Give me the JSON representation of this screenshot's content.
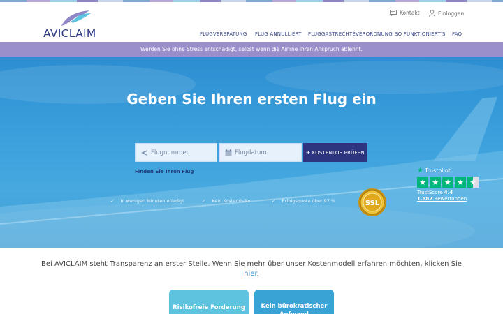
{
  "brand": {
    "name": "AVICLAIM"
  },
  "utility": {
    "contact": "Kontakt",
    "login": "Einloggen"
  },
  "nav": [
    {
      "label": "FLUGVERSPÄTUNG"
    },
    {
      "label": "FLUG ANNULLIERT"
    },
    {
      "label": "FLUGGASTRECHTEVERORDNUNG"
    },
    {
      "label": "SO FUNKTIONIERT'S"
    },
    {
      "label": "FAQ"
    }
  ],
  "banner": {
    "text": "Werden Sie ohne Stress entschädigt, selbst wenn die Airline Ihren Anspruch ablehnt."
  },
  "hero": {
    "title": "Geben Sie Ihren ersten Flug ein",
    "flight_placeholder": "Flugnummer",
    "date_placeholder": "Flugdatum",
    "cta_label": "✈ KOSTENLOS PRÜFEN",
    "find_link": "Finden Sie Ihren Flug",
    "features": [
      "In wenigen Minuten erledigt",
      "Kein Kostenrisiko",
      "Erfolgsquote über 97 %"
    ],
    "ssl_badge": "SSL"
  },
  "trustpilot": {
    "name": "Trustpilot",
    "score_label": "TrustScore",
    "score": "4.4",
    "reviews_count": "1.882",
    "reviews_label": "Bewertungen",
    "rating": 4.5
  },
  "transparency": {
    "text": "Bei AVICLAIM steht Transparenz an erster Stelle. Wenn Sie mehr über unser Kostenmodell erfahren möchten, klicken Sie",
    "link": "hier",
    "end": "."
  },
  "cards": [
    {
      "label": "Risikofreie Forderung"
    },
    {
      "label": "Kein bürokratischer Aufwand"
    }
  ],
  "colors": {
    "brand_navy": "#2d3480",
    "banner_purple": "#9b8fcb",
    "hero_blue": "#3a9fdc",
    "trustpilot_green": "#00b67a"
  }
}
